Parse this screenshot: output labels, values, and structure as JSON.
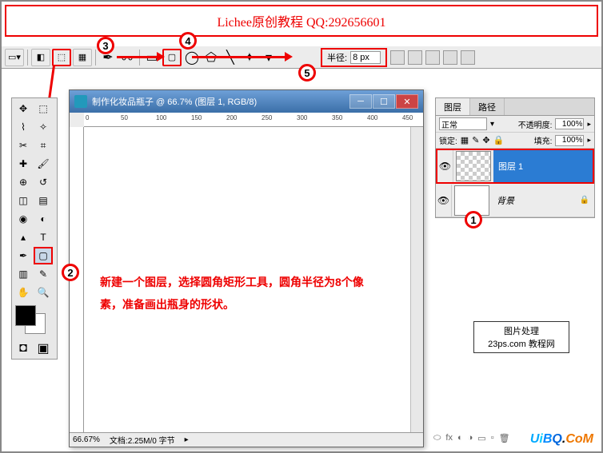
{
  "banner": {
    "text": "Lichee原创教程 QQ:292656601"
  },
  "options_bar": {
    "radius_label": "半径:",
    "radius_value": "8 px"
  },
  "markers": {
    "n1": "1",
    "n2": "2",
    "n3": "3",
    "n4": "4",
    "n5": "5"
  },
  "document": {
    "title": "制作化妆品瓶子 @ 66.7% (图层 1, RGB/8)",
    "instruction_line1": "新建一个图层，选择圆角矩形工具，圆角半径为8个像",
    "instruction_line2": "素，准备画出瓶身的形状。",
    "zoom": "66.67%",
    "doc_info": "文档:2.25M/0 字节",
    "ruler_marks": [
      "0",
      "50",
      "100",
      "150",
      "200",
      "250",
      "300",
      "350",
      "400",
      "450"
    ]
  },
  "layers_panel": {
    "tab_layers": "图层",
    "tab_paths": "路径",
    "blend_mode": "正常",
    "opacity_label": "不透明度:",
    "opacity_value": "100%",
    "lock_label": "锁定:",
    "fill_label": "填充:",
    "fill_value": "100%",
    "layers": [
      {
        "name": "图层 1",
        "selected": true,
        "bg": false
      },
      {
        "name": "背景",
        "selected": false,
        "bg": true
      }
    ]
  },
  "watermark": {
    "line1": "图片处理",
    "line2": "23ps.com 教程网"
  },
  "brand": {
    "text": "UiBQ.CoM"
  }
}
